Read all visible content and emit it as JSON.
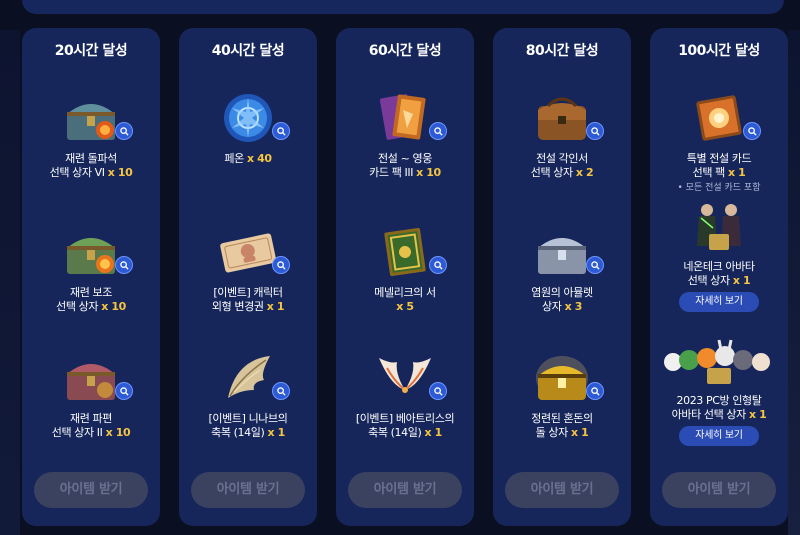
{
  "columns": [
    {
      "title": "20시간 달성",
      "claim_label": "아이템 받기",
      "rewards": [
        {
          "name": "재련 돌파석\n선택 상자 VI",
          "qty": "x 10",
          "icon": "teal-treasure-chest-icon"
        },
        {
          "name": "재련 보조\n선택 상자",
          "qty": "x 10",
          "icon": "green-treasure-chest-icon"
        },
        {
          "name": "재련 파편\n선택 상자 II",
          "qty": "x 10",
          "icon": "red-treasure-chest-icon"
        }
      ]
    },
    {
      "title": "40시간 달성",
      "claim_label": "아이템 받기",
      "rewards": [
        {
          "name": "페온",
          "qty": "x 40",
          "icon": "blue-medallion-icon"
        },
        {
          "name": "[이벤트] 캐릭터\n외형 변경권",
          "qty": "x 1",
          "icon": "ticket-icon"
        },
        {
          "name": "[이벤트] 니나브의\n축복 (14일)",
          "qty": "x 1",
          "icon": "feather-wing-icon"
        }
      ]
    },
    {
      "title": "60시간 달성",
      "claim_label": "아이템 받기",
      "rewards": [
        {
          "name": "전설 ~ 영웅\n카드 팩 III",
          "qty": "x 10",
          "icon": "card-pack-icon"
        },
        {
          "name": "메넬리크의 서",
          "qty": "x 5",
          "icon": "golden-book-icon"
        },
        {
          "name": "[이벤트] 베아트리스의\n축복 (14일)",
          "qty": "x 1",
          "icon": "angel-wings-icon"
        }
      ]
    },
    {
      "title": "80시간 달성",
      "claim_label": "아이템 받기",
      "rewards": [
        {
          "name": "전설 각인서\n선택 상자",
          "qty": "x 2",
          "icon": "leather-satchel-icon"
        },
        {
          "name": "염원의 아뮬렛\n상자",
          "qty": "x 3",
          "icon": "silver-chest-icon"
        },
        {
          "name": "정련된 혼돈의\n돌 상자",
          "qty": "x 1",
          "icon": "gold-chest-icon"
        }
      ]
    },
    {
      "title": "100시간 달성",
      "claim_label": "아이템 받기",
      "rewards": [
        {
          "name": "특별 전설 카드\n선택 팩",
          "qty": "x 1",
          "note": "• 모든 전설 카드 포함",
          "icon": "card-book-icon"
        },
        {
          "name": "네온테크 아바타\n선택 상자",
          "qty": "x 1",
          "detail": "자세히 보기",
          "icon": "neontech-avatar-icon"
        },
        {
          "name": "2023 PC방 인형탈\n아바타 선택 상자",
          "qty": "x 1",
          "detail": "자세히 보기",
          "icon": "mascot-avatar-icon"
        }
      ]
    }
  ],
  "colors": {
    "panel": "#16265b",
    "qty": "#f5c542",
    "claim_disabled": "#3a4260",
    "detail_btn": "#2b4bb5"
  }
}
